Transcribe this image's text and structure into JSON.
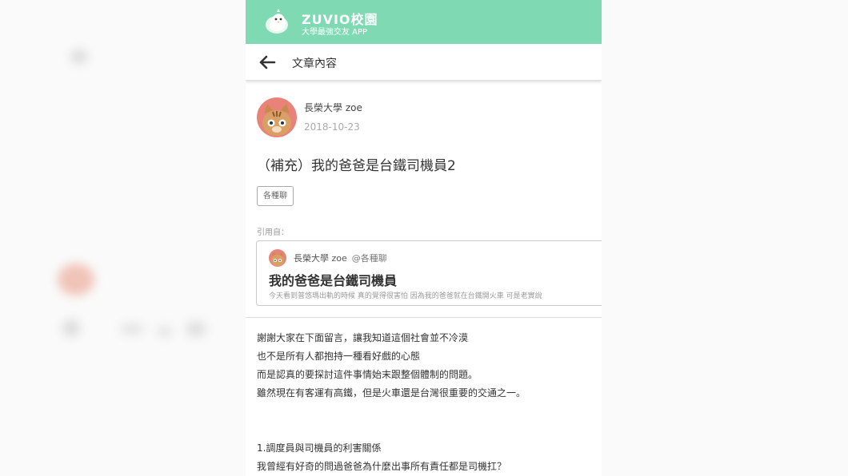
{
  "header": {
    "brand": "ZUVIO校園",
    "tagline": "大學最強交友 APP"
  },
  "nav": {
    "title": "文章內容",
    "back_icon": "arrow-left-icon"
  },
  "post": {
    "author": "長榮大學 zoe",
    "date": "2018-10-23",
    "title": "（補充）我的爸爸是台鐵司機員2",
    "tag": "各種聊",
    "quote_label": "引用自：",
    "quote": {
      "author": "長榮大學 zoe",
      "board": "@各種聊",
      "title": "我的爸爸是台鐵司機員",
      "excerpt": "今天看到普悠瑪出軌的時候 真的覺得很害怕 因為我的爸爸就在台鐵開火車 可是老實說"
    },
    "body": [
      "謝謝大家在下面留言，讓我知道這個社會並不冷漠",
      "也不是所有人都抱持一種看好戲的心態",
      "而是認真的要探討這件事情始末跟整個體制的問題。",
      "雖然現在有客運有高鐵，但是火車還是台灣很重要的交通之一。",
      "1.調度員與司機員的利害關係",
      "我曾經有好奇的問過爸爸為什麼出事所有責任都是司機扛？"
    ]
  },
  "colors": {
    "brand_green": "#7fd9b3",
    "avatar_bg": "#e9837a"
  }
}
